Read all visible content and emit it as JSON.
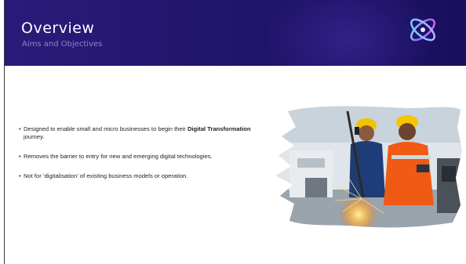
{
  "slide": {
    "title": "Overview",
    "subtitle": "Aims and Objectives",
    "logo_icon": "orbit-swirl-logo-icon",
    "header_color": "#23166e",
    "bullets": [
      {
        "pre": "Designed to enable small and micro businesses to begin their ",
        "bold": "Digital Transformation",
        "post": " journey."
      },
      {
        "text": "Removes the barrier to entry for new and emerging digital technologies."
      },
      {
        "text": "Not for ‘digitalisation’ of existing business models or operation."
      }
    ],
    "photo_icon": "industrial-workers-photo"
  }
}
